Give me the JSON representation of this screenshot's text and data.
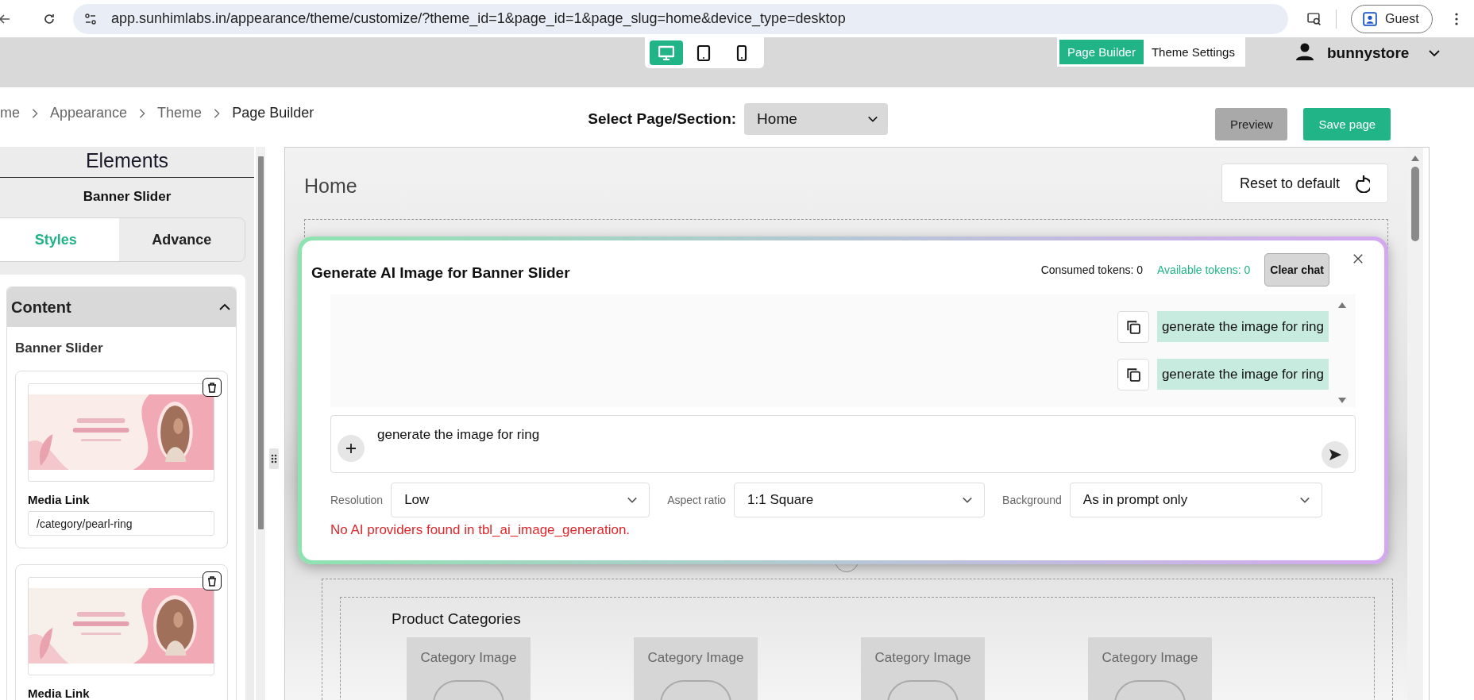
{
  "browser": {
    "url": "app.sunhimlabs.in/appearance/theme/customize/?theme_id=1&page_id=1&page_slug=home&device_type=desktop",
    "profile": "Guest"
  },
  "header": {
    "devices": [
      {
        "kind": "desktop",
        "selected": true
      },
      {
        "kind": "tablet",
        "selected": false
      },
      {
        "kind": "mobile",
        "selected": false
      }
    ],
    "modes": [
      {
        "label": "Page Builder",
        "selected": true
      },
      {
        "label": "Theme Settings",
        "selected": false
      }
    ],
    "user": "bunnystore"
  },
  "breadcrumb": [
    "me",
    "Appearance",
    "Theme",
    "Page Builder"
  ],
  "page_select": {
    "label": "Select Page/Section:",
    "value": "Home"
  },
  "actions": [
    {
      "label": "Preview",
      "kind": "secondary"
    },
    {
      "label": "Save page",
      "kind": "primary"
    }
  ],
  "sidebar": {
    "title": "Elements",
    "element": "Banner Slider",
    "tabs": [
      {
        "label": "Styles",
        "selected": true
      },
      {
        "label": "Advance",
        "selected": false
      }
    ],
    "section": {
      "title": "Content",
      "expanded": true,
      "subtitle": "Banner Slider",
      "slides": [
        {
          "kind": "picture",
          "link_label": "Media Link",
          "link": "/category/pearl-ring"
        },
        {
          "kind": "picture",
          "link_label": "Media Link"
        }
      ]
    }
  },
  "canvas": {
    "title": "Home",
    "reset_button": "Reset to default",
    "categories_title": "Product Categories",
    "categories": [
      "Category Image",
      "Category Image",
      "Category Image",
      "Category Image"
    ]
  },
  "modal": {
    "title": "Generate AI Image for Banner Slider",
    "consumed": "Consumed tokens: 0",
    "available": "Available tokens: 0",
    "clear_button": "Clear chat",
    "messages": [
      "generate the image for ring",
      "generate the image for ring"
    ],
    "prompt": "generate the image for ring",
    "options": [
      {
        "label": "Resolution",
        "value": "Low"
      },
      {
        "label": "Aspect ratio",
        "value": "1:1 Square"
      },
      {
        "label": "Background",
        "value": "As in prompt only"
      }
    ],
    "error": "No AI providers found in tbl_ai_image_generation."
  }
}
